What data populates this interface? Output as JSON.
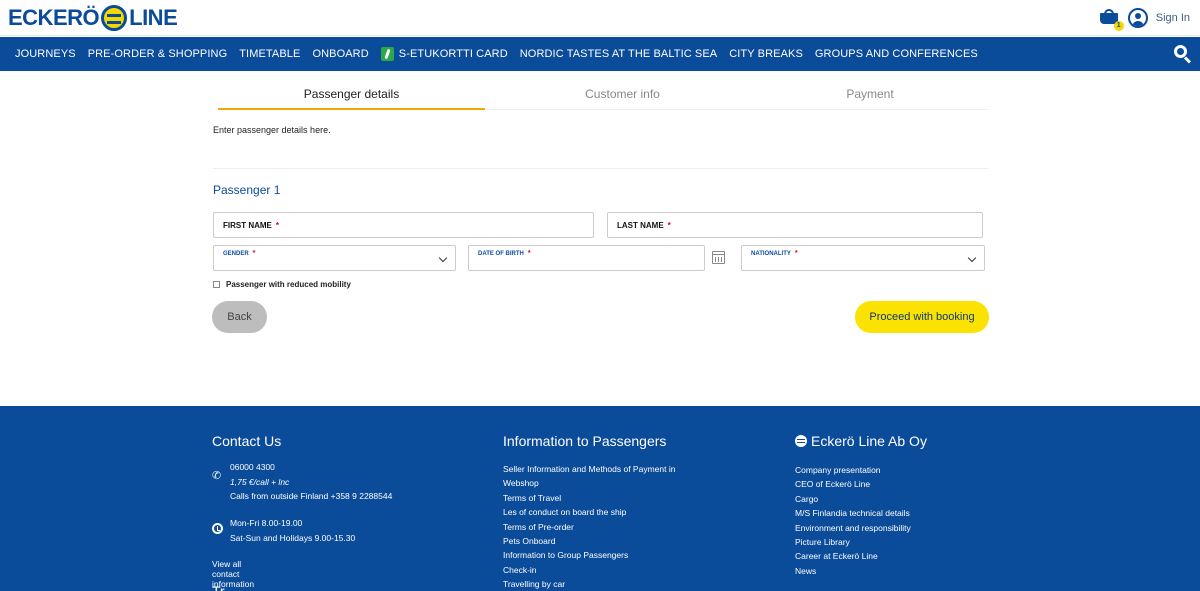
{
  "header": {
    "logo_text_left": "ECKERÖ",
    "logo_text_right": "LINE",
    "cart_count": "1",
    "signin_label": "Sign In"
  },
  "nav": {
    "items": [
      "JOURNEYS",
      "PRE-ORDER & SHOPPING",
      "TIMETABLE",
      "ONBOARD",
      "S-ETUKORTTI CARD",
      "NORDIC TASTES AT THE BALTIC SEA",
      "CITY BREAKS",
      "GROUPS AND CONFERENCES"
    ]
  },
  "steps": {
    "items": [
      "Passenger details",
      "Customer info",
      "Payment"
    ],
    "active": "Passenger details"
  },
  "form": {
    "intro": "Enter passenger details here.",
    "passenger_title": "Passenger 1",
    "first_name_label": "FIRST NAME",
    "last_name_label": "LAST NAME",
    "gender_label": "GENDER",
    "dob_label": "DATE OF BIRTH",
    "nationality_label": "NATIONALITY",
    "required_mark": "*",
    "reduced_mobility_label": "Passenger with reduced mobility",
    "back_label": "Back",
    "proceed_label": "Proceed with booking"
  },
  "footer": {
    "contact": {
      "title": "Contact Us",
      "phone": "06000 4300",
      "phone_cost": "1,75 €/call + lnc",
      "abroad": "Calls from outside Finland +358 9 2288544",
      "hours_weekdays": "Mon-Fri 8.00-19.00",
      "hours_weekend": "Sat-Sun and Holidays 9.00-15.30",
      "view_all": "View all contact information",
      "partial_heading": "Tr..."
    },
    "info": {
      "title": "Information to Passengers",
      "links": [
        "Seller Information and Methods of Payment in",
        "Webshop",
        "Terms of Travel",
        "Les of conduct on board the ship",
        "Terms of Pre-order",
        "Pets Onboard",
        "Information to Group Passengers",
        "Check-in",
        "Travelling by car"
      ]
    },
    "company": {
      "title": "Eckerö Line Ab Oy",
      "links": [
        "Company presentation",
        "CEO of Eckerö Line",
        "Cargo",
        "M/S Finlandia technical details",
        "Environment and responsibility",
        "Picture Library",
        "Career at Eckerö Line",
        "News"
      ]
    }
  },
  "colors": {
    "brand_blue": "#0a4b9a",
    "brand_yellow": "#fbe200",
    "step_accent": "#f2a900",
    "required_red": "#d0021b"
  }
}
